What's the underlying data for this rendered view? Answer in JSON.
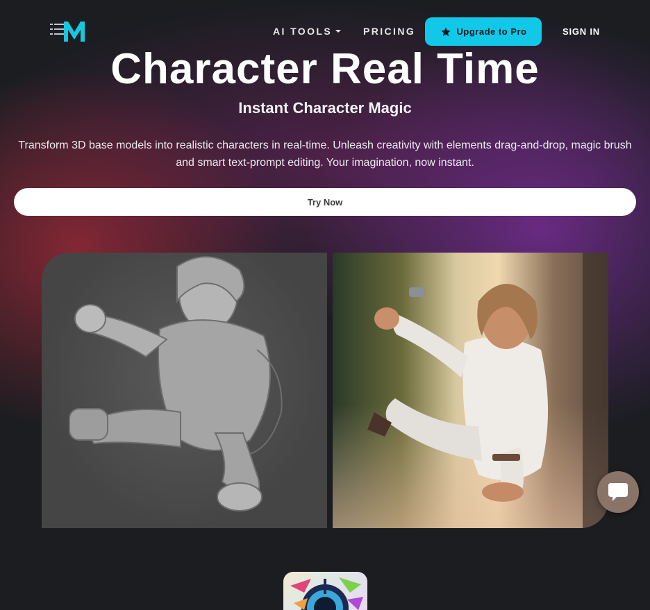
{
  "nav": {
    "ai_tools_label": "AI TOOLS",
    "pricing_label": "PRICING",
    "upgrade_label": "Upgrade to Pro",
    "sign_in_label": "SIGN IN",
    "logo_icon": "menu-m-logo-icon"
  },
  "hero": {
    "title": "Character Real Time",
    "subtitle": "Instant Character Magic",
    "description": "Transform 3D base models into realistic characters in real-time. Unleash creativity with elements drag-and-drop, magic brush and smart text-prompt editing. Your imagination, now instant.",
    "cta_label": "Try Now"
  },
  "colors": {
    "accent": "#12c8e8",
    "background": "#1b1d21",
    "chat_bubble": "#8a7468"
  },
  "icons": {
    "upgrade": "star-icon",
    "chat": "chat-bubble-icon",
    "dropdown": "caret-down-icon"
  }
}
